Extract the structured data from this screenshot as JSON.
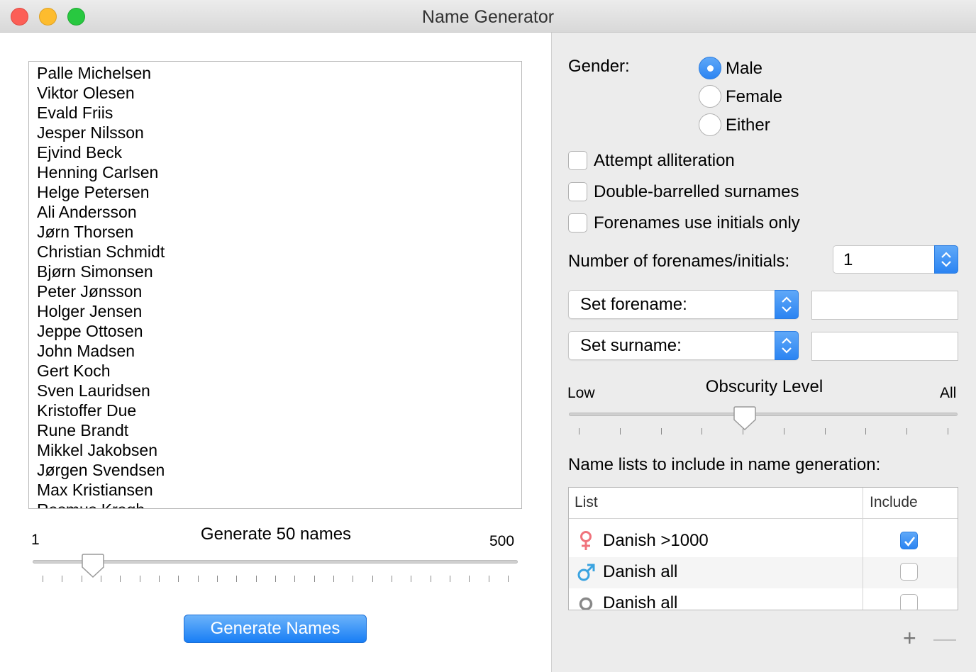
{
  "window": {
    "title": "Name Generator"
  },
  "names": [
    "Palle Michelsen",
    "Viktor Olesen",
    "Evald Friis",
    "Jesper Nilsson",
    "Ejvind Beck",
    "Henning Carlsen",
    "Helge Petersen",
    "Ali Andersson",
    "Jørn Thorsen",
    "Christian Schmidt",
    "Bjørn Simonsen",
    "Peter Jønsson",
    "Holger Jensen",
    "Jeppe Ottosen",
    "John Madsen",
    "Gert Koch",
    "Sven Lauridsen",
    "Kristoffer Due",
    "Rune Brandt",
    "Mikkel Jakobsen",
    "Jørgen Svendsen",
    "Max Kristiansen",
    "Rasmus Kragh"
  ],
  "count_slider": {
    "label": "Generate 50 names",
    "min_label": "1",
    "max_label": "500",
    "min": 1,
    "max": 500,
    "value": 50
  },
  "generate_button": "Generate Names",
  "gender": {
    "label": "Gender:",
    "options": [
      "Male",
      "Female",
      "Either"
    ],
    "selected": "Male"
  },
  "checkboxes": {
    "alliteration": "Attempt alliteration",
    "double_barrelled": "Double-barrelled surnames",
    "initials_only": "Forenames use initials only"
  },
  "forenames_count": {
    "label": "Number of forenames/initials:",
    "value": "1"
  },
  "set_forename": {
    "label": "Set forename:",
    "value": ""
  },
  "set_surname": {
    "label": "Set surname:",
    "value": ""
  },
  "obscurity": {
    "title": "Obscurity Level",
    "low_label": "Low",
    "high_label": "All",
    "value_fraction": 0.45
  },
  "name_lists": {
    "heading": "Name lists to include in name generation:",
    "columns": [
      "List",
      "Include"
    ],
    "rows": [
      {
        "name": "Danish >1000",
        "icon": "female-icon",
        "included": true
      },
      {
        "name": "Danish all",
        "icon": "male-icon",
        "included": false
      },
      {
        "name": "Danish all",
        "icon": "neutral-icon",
        "included": false
      }
    ]
  },
  "list_buttons": {
    "add": "+",
    "remove": "—"
  },
  "colors": {
    "accent": "#2b84f2",
    "female_icon": "#f0737c",
    "male_icon": "#3aa3e0",
    "neutral_icon": "#888888"
  }
}
